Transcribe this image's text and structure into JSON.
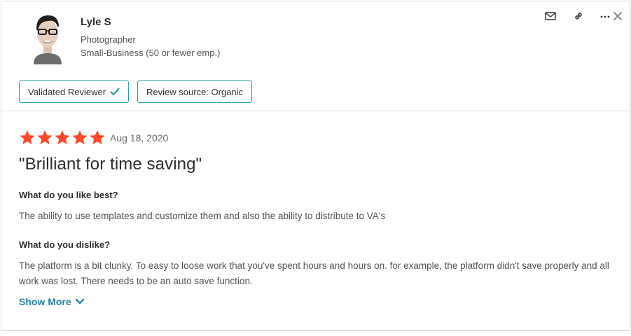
{
  "reviewer": {
    "name": "Lyle S",
    "role": "Photographer",
    "company_size": "Small-Business (50 or fewer emp.)"
  },
  "badges": {
    "validated": "Validated Reviewer",
    "source": "Review source: Organic"
  },
  "actions": [
    "mail-icon",
    "link-icon",
    "more-icon",
    "close-icon"
  ],
  "review": {
    "rating": 5,
    "rating_max": 5,
    "date": "Aug 18, 2020",
    "title": "\"Brilliant for time saving\"",
    "q_like": "What do you like best?",
    "a_like": "The ability to use templates and customize them and also the ability to distribute to VA's",
    "q_dislike": "What do you dislike?",
    "a_dislike": "The platform is a bit clunky. To easy to loose work that you've spent hours and hours on. for example, the platform didn't save properly and all work was lost. There needs to be an auto save function.",
    "show_more": "Show More"
  },
  "colors": {
    "star": "#ff492c",
    "badge_border": "#27a3a0",
    "check": "#27a3a0",
    "link": "#2b7fa8"
  }
}
